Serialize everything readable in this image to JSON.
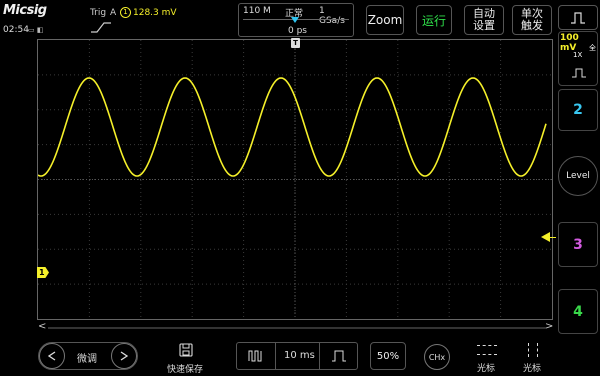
{
  "brand": "Micsig",
  "clock": "02:54",
  "trigger": {
    "label": "Trig",
    "channel": "A",
    "level": "128.3 mV"
  },
  "timebase": {
    "depth": "110 M",
    "mode": "正常",
    "rate": "1 GSa/s",
    "offset": "0 ps",
    "marker": "T"
  },
  "top_buttons": {
    "zoom": "Zoom",
    "run": "运行",
    "auto_line1": "自动",
    "auto_line2": "设置",
    "single_line1": "单次",
    "single_line2": "触发"
  },
  "ch1": {
    "scale": "100 mV",
    "full": "全",
    "probe": "1X",
    "marker": "1",
    "color": "#f5f02a"
  },
  "channels": {
    "ch2": "2",
    "ch3": "3",
    "ch4": "4",
    "ch2_color": "#39c7f0",
    "ch3_color": "#d25adf",
    "ch4_color": "#39d84a"
  },
  "level_button": "Level",
  "scroll": {
    "left": "<",
    "right": ">"
  },
  "bottom": {
    "fine": "微调",
    "quicksave": "快速保存",
    "time_div": "10 ms",
    "percent": "50%",
    "chx": "CHx",
    "cursor1": "光标",
    "cursor2": "光标"
  },
  "colors": {
    "trace": "#f5f02a",
    "grid": "#3a3a3a",
    "accent": "#2ec4f0"
  }
}
